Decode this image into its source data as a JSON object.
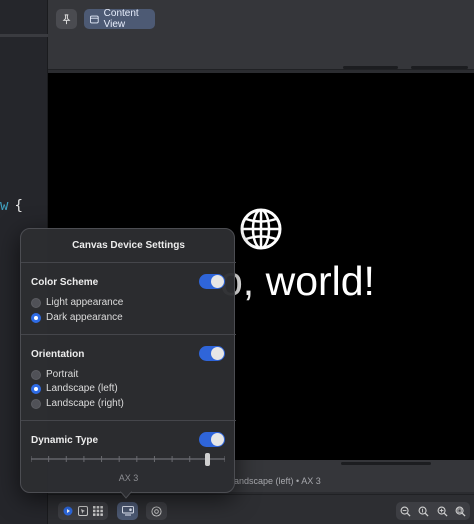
{
  "editor": {
    "code_keyword": "w",
    "code_brace": "{"
  },
  "preview_toolbar": {
    "pin_icon": "pin-icon",
    "content_view_label": "Content View"
  },
  "canvas": {
    "greeting_visible": "o, world!",
    "icon": "globe-icon",
    "caption": "landscape (left) • AX 3"
  },
  "popover": {
    "title": "Canvas Device Settings",
    "color_scheme": {
      "label": "Color Scheme",
      "enabled": true,
      "options": [
        "Light appearance",
        "Dark appearance"
      ],
      "selected": "Dark appearance"
    },
    "orientation": {
      "label": "Orientation",
      "enabled": true,
      "options": [
        "Portrait",
        "Landscape (left)",
        "Landscape (right)"
      ],
      "selected": "Landscape (left)"
    },
    "dynamic_type": {
      "label": "Dynamic Type",
      "enabled": true,
      "steps": 12,
      "value_index": 10,
      "value_label": "AX 3"
    }
  },
  "bottom_bar": {
    "modes": [
      "live-icon",
      "select-icon",
      "grid-icon"
    ],
    "device_settings_icon": "device-settings-icon",
    "variants_icon": "variants-icon",
    "zoom_icons": [
      "zoom-out-icon",
      "zoom-100-icon",
      "zoom-in-icon",
      "zoom-fit-icon"
    ]
  },
  "colors": {
    "accent": "#2f65d9",
    "canvas_bg": "#000000",
    "chrome_bg": "#35363a"
  }
}
